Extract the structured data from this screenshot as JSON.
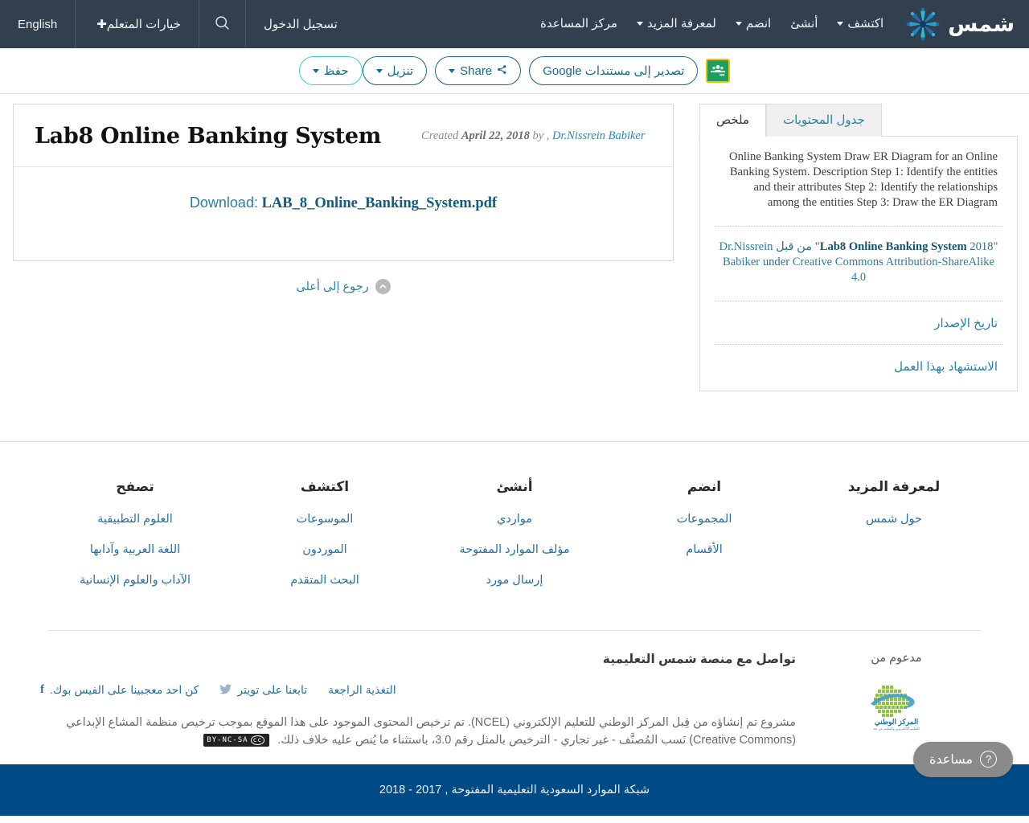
{
  "navbar": {
    "brand_text": "شمس",
    "links": [
      {
        "label": "اكتشف",
        "has_caret": true
      },
      {
        "label": "أنشئ",
        "has_caret": false
      },
      {
        "label": "انضم",
        "has_caret": true
      },
      {
        "label": "لمعرفة المزيد",
        "has_caret": true
      },
      {
        "label": "مركز المساعدة",
        "has_caret": false
      }
    ],
    "login_label": "تسجيل الدخول",
    "search_icon": "search-icon",
    "learner_options_label": "خيارات المتعلم",
    "language_label": "English"
  },
  "toolbar": {
    "save_label": "حفظ",
    "download_label": "تنزيل",
    "share_label": "Share",
    "google_docs_label": "تصدير إلى مستندات Google",
    "classroom_icon": "google-classroom-icon"
  },
  "sidebar": {
    "tabs": [
      {
        "label": "ملخص",
        "active": true
      },
      {
        "label": "جدول المحتويات",
        "active": false
      }
    ],
    "summary": "Online Banking System Draw ER Diagram for an Online Banking System. Description Step 1: Identify the entities and their attributes Step 2: Identify the relationships among the entities Step 3: Draw the ER Diagram",
    "attribution": {
      "quote_open": "\"",
      "year": "2018",
      "work_title": "Lab8 Online Banking System",
      "quote_close": "\"",
      "by_word": "من قبل",
      "author": "Dr.Nissrein Babiker",
      "under_word": "under",
      "license": "Creative Commons Attribution-ShareAlike 4.0"
    },
    "links": [
      {
        "label": "تاريخ الإصدار"
      },
      {
        "label": "الاستشهاد بهذا العمل"
      }
    ]
  },
  "document": {
    "title": "Lab8 Online Banking System",
    "created_label": "Created",
    "created_date": "April 22, 2018",
    "by_label": "by ,",
    "author": "Dr.Nissrein Babiker",
    "download_label": "Download:",
    "file_name": "LAB_8_Online_Banking_System.pdf",
    "back_to_top": "رجوع إلى أعلى",
    "back_to_top_icon": "chevron-up-circle-icon"
  },
  "footer": {
    "columns": [
      {
        "heading": "تصفح",
        "links": [
          "العلوم التطبيقية",
          "اللغة العربية وآدابها",
          "الآداب والعلوم الإنسانية"
        ]
      },
      {
        "heading": "اكتشف",
        "links": [
          "الموسوعات",
          "الموردون",
          "البحث المتقدم"
        ]
      },
      {
        "heading": "أنشئ",
        "links": [
          "مواردي",
          "مؤلف الموارد المفتوحة",
          "إرسال مورد"
        ]
      },
      {
        "heading": "انضم",
        "links": [
          "المجموعات",
          "الأقسام"
        ]
      },
      {
        "heading": "لمعرفة المزيد",
        "links": [
          "حول شمس"
        ]
      }
    ],
    "connect": {
      "heading": "تواصل مع منصة شمس التعليمية",
      "facebook": "كن احد معجبينا على الفيس بوك.",
      "twitter": "تابعنا على تويتر",
      "feedback": "التغذية الراجعة"
    },
    "license_text_1": "مشروع تم إنشاؤه من قِبل المركز الوطني للتعليم الإلكتروني (NCEL). تم ترخيص المحتوى الموجود على هذا الموقع بموجب ترخيص منظمة المشاع الإبداعي (Creative Commons) نَسب المُصنَّف - غير تجاري - الترخيص بالمثل رقم 3.0، باستثناء ما يُنص عليه خلاف ذلك.",
    "cc_badge_mark": "cc",
    "cc_badge_text": "BY-NC-SA",
    "support_label": "مدعوم من",
    "support_logo_icon": "ncel-logo-icon"
  },
  "bottom": {
    "copyright": "شبكة الموارد السعودية التعليمية المفتوحة , 2017 - 2018",
    "help_label": "مساعدة",
    "help_icon": "question-circle-icon"
  },
  "colors": {
    "navbar_bg": "#323f4f",
    "bottom_bar_bg": "#004b85",
    "link_blue": "#2a6f9e",
    "accent_teal": "#19698a",
    "cyan": "#3ec8e0"
  }
}
